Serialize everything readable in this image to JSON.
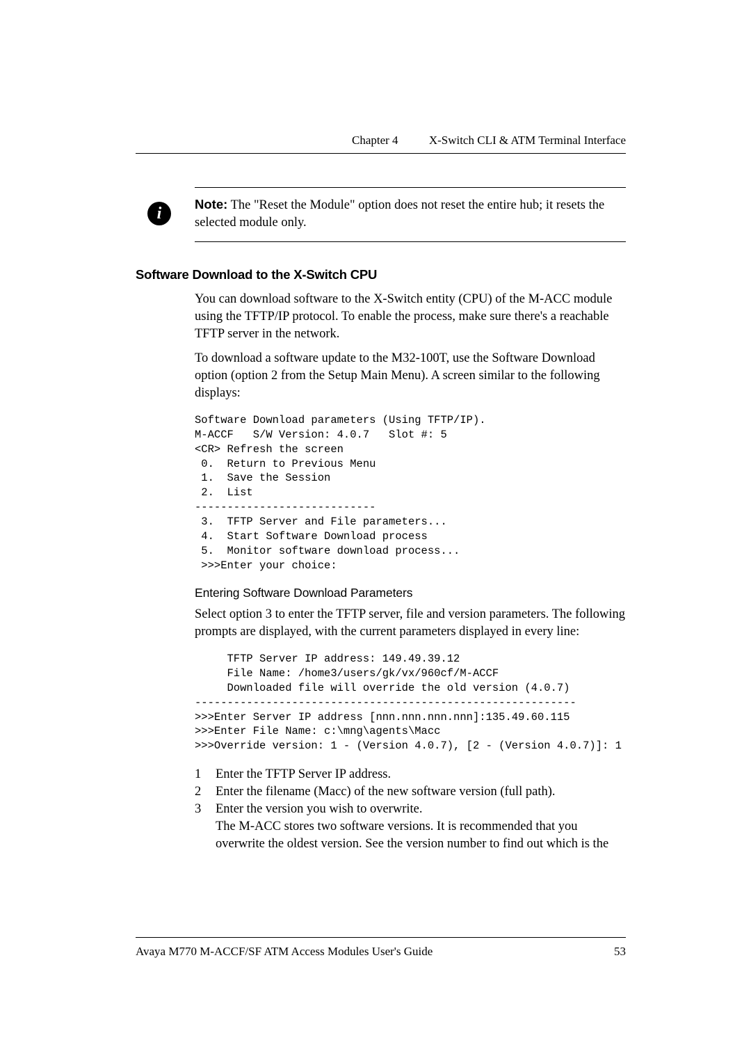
{
  "header": {
    "chapter": "Chapter 4",
    "title": "X-Switch CLI & ATM Terminal Interface"
  },
  "note": {
    "label": "Note:",
    "text": "The \"Reset the Module\" option does not reset the entire hub; it resets the selected module only."
  },
  "section1": {
    "heading": "Software Download to the X-Switch CPU",
    "para1": "You can download software to the X-Switch entity (CPU) of the M-ACC module using the TFTP/IP protocol. To enable the process, make sure there's a reachable TFTP server in the network.",
    "para2": "To download a software update to the M32-100T, use the Software Download option (option 2 from the Setup Main Menu). A screen similar to the following displays:"
  },
  "code1": "Software Download parameters (Using TFTP/IP).\nM-ACCF   S/W Version: 4.0.7   Slot #: 5\n<CR> Refresh the screen\n 0.  Return to Previous Menu\n 1.  Save the Session\n 2.  List\n----------------------------\n 3.  TFTP Server and File parameters...\n 4.  Start Software Download process\n 5.  Monitor software download process...\n >>>Enter your choice:",
  "section2": {
    "heading": "Entering Software Download Parameters",
    "para1": "Select option 3 to enter the TFTP server, file and version parameters.  The following prompts are displayed, with the current parameters displayed in every line:"
  },
  "code2": "     TFTP Server IP address: 149.49.39.12\n     File Name: /home3/users/gk/vx/960cf/M-ACCF\n     Downloaded file will override the old version (4.0.7)\n-----------------------------------------------------------\n>>>Enter Server IP address [nnn.nnn.nnn.nnn]:135.49.60.115\n>>>Enter File Name: c:\\mng\\agents\\Macc\n>>>Override version: 1 - (Version 4.0.7), [2 - (Version 4.0.7)]: 1",
  "steps": [
    {
      "num": "1",
      "text": "Enter the TFTP Server IP address."
    },
    {
      "num": "2",
      "text": "Enter the filename (Macc) of the new software version (full path)."
    },
    {
      "num": "3",
      "text": "Enter the version you wish to overwrite."
    }
  ],
  "steps_after": "The M-ACC stores two software versions.  It is recommended that you overwrite the oldest version.  See the version number to find out which is the",
  "footer": {
    "left": "Avaya M770 M-ACCF/SF ATM Access Modules User's Guide",
    "right": "53"
  }
}
